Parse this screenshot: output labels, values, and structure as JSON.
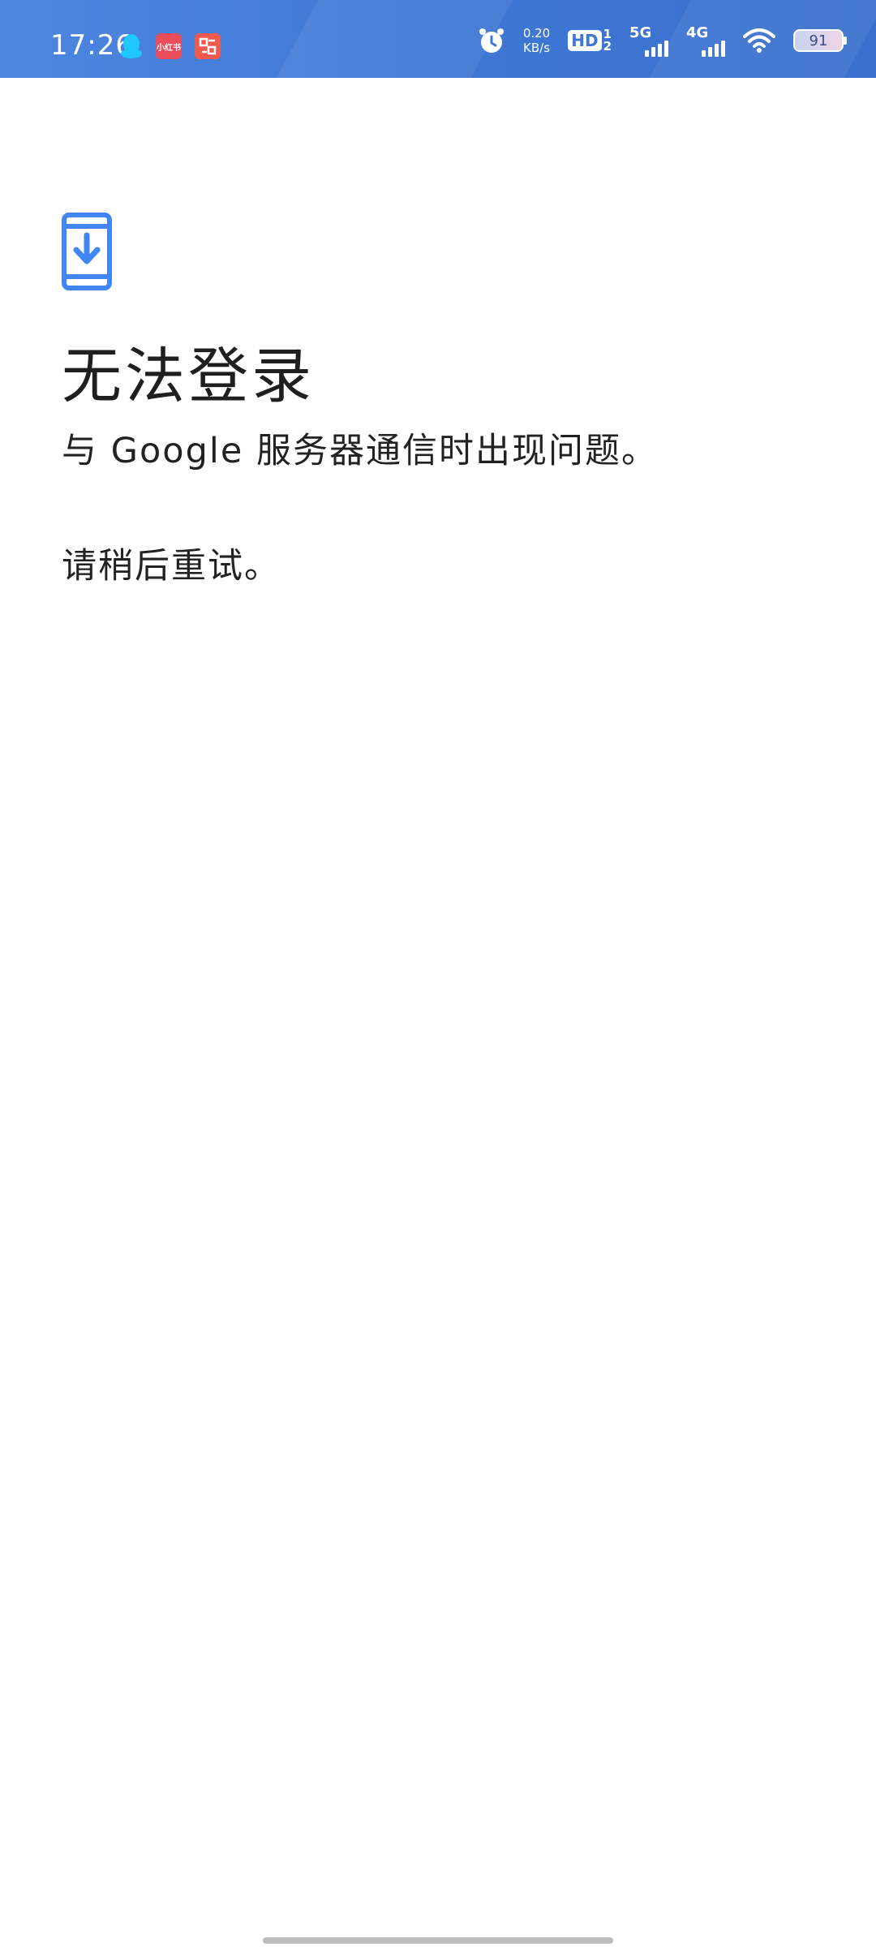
{
  "status_bar": {
    "time": "17:26",
    "net_speed_value": "0.20",
    "net_speed_unit": "KB/s",
    "hd_label": "HD",
    "hd_sim_1": "1",
    "hd_sim_2": "2",
    "signal_1_label": "5G",
    "signal_2_label": "4G",
    "battery_level": "91",
    "app_badge_1": "小红书",
    "app_badge_2": "APP",
    "icons": [
      "qq-icon",
      "xiaohongshu-app-icon",
      "app-icon",
      "alarm-icon",
      "hd-voice-icon",
      "signal-5g-icon",
      "signal-4g-icon",
      "wifi-icon",
      "battery-icon"
    ]
  },
  "page": {
    "icon": "phone-download-icon",
    "title": "无法登录",
    "message": "与 Google 服务器通信时出现问题。",
    "retry_hint": "请稍后重试。"
  },
  "colors": {
    "status_bar": "#3f77d4",
    "accent": "#4285f4",
    "text": "#222222",
    "background": "#ffffff"
  }
}
